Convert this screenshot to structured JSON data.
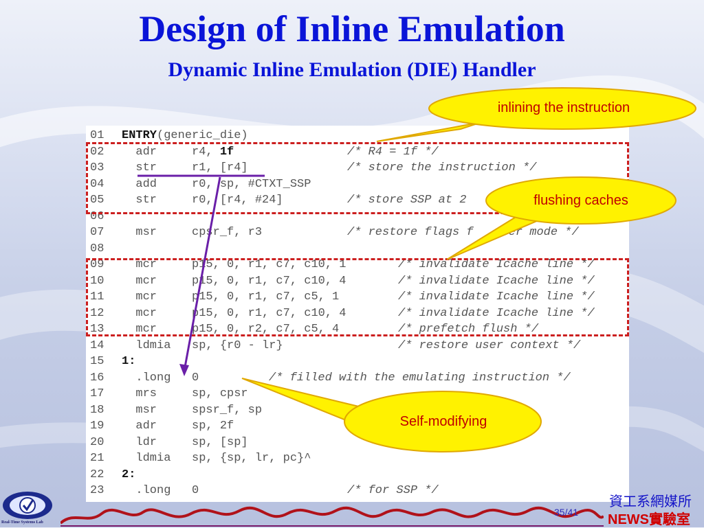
{
  "slide": {
    "title": "Design of Inline Emulation",
    "subtitle": "Dynamic Inline Emulation (DIE) Handler",
    "page_number": "35/41",
    "lab_caption": "Real-Time Systems Lab",
    "dept_line1": "資工系網媒所",
    "dept_line2": "NEWS實驗室"
  },
  "callouts": {
    "inlining": "inlining the instruction",
    "flushing": "flushing caches",
    "self_modifying": "Self-modifying"
  },
  "code_lines": [
    {
      "ln": "01",
      "pre": "",
      "bold": "ENTRY",
      "rest": "(generic_die)",
      "comment": ""
    },
    {
      "ln": "02",
      "pre": "  adr     r4, ",
      "bold": "1f",
      "rest": "",
      "comment": "/* R4 = 1f */"
    },
    {
      "ln": "03",
      "pre": "  str     r1, [r4]",
      "bold": "",
      "rest": "",
      "comment": "/* store the instruction */"
    },
    {
      "ln": "04",
      "pre": "  add     r0, sp, #CTXT_SSP",
      "bold": "",
      "rest": "",
      "comment": ""
    },
    {
      "ln": "05",
      "pre": "  str     r0, [r4, #24]",
      "bold": "",
      "rest": "",
      "comment": "/* store SSP at 2"
    },
    {
      "ln": "06",
      "pre": "",
      "bold": "",
      "rest": "",
      "comment": ""
    },
    {
      "ln": "07",
      "pre": "  msr     cpsr_f, r3",
      "bold": "",
      "rest": "",
      "comment": "/* restore flags f   user mode */"
    },
    {
      "ln": "08",
      "pre": "",
      "bold": "",
      "rest": "",
      "comment": ""
    },
    {
      "ln": "09",
      "pre": "  mcr     p15, 0, r1, c7, c10, 1",
      "bold": "",
      "rest": "",
      "comment": "/* invalidate Icache line */"
    },
    {
      "ln": "10",
      "pre": "  mcr     p15, 0, r1, c7, c10, 4",
      "bold": "",
      "rest": "",
      "comment": "/* invalidate Icache line */"
    },
    {
      "ln": "11",
      "pre": "  mcr     p15, 0, r1, c7, c5, 1",
      "bold": "",
      "rest": "",
      "comment": "/* invalidate Icache line */"
    },
    {
      "ln": "12",
      "pre": "  mcr     p15, 0, r1, c7, c10, 4",
      "bold": "",
      "rest": "",
      "comment": "/* invalidate Icache line */"
    },
    {
      "ln": "13",
      "pre": "  mcr     p15, 0, r2, c7, c5, 4",
      "bold": "",
      "rest": "",
      "comment": "/* prefetch flush */"
    },
    {
      "ln": "14",
      "pre": "  ldmia   sp, {r0 - lr}",
      "bold": "",
      "rest": "",
      "comment": "/* restore user context */"
    },
    {
      "ln": "15",
      "pre": "",
      "bold": "1:",
      "rest": "",
      "comment": ""
    },
    {
      "ln": "16",
      "pre": "  .long   0",
      "bold": "",
      "rest": "",
      "comment": "/* filled with the emulating instruction */"
    },
    {
      "ln": "17",
      "pre": "  mrs     sp, cpsr",
      "bold": "",
      "rest": "",
      "comment": ""
    },
    {
      "ln": "18",
      "pre": "  msr     spsr_f, sp",
      "bold": "",
      "rest": "",
      "comment": ""
    },
    {
      "ln": "19",
      "pre": "  adr     sp, 2f",
      "bold": "",
      "rest": "",
      "comment": ""
    },
    {
      "ln": "20",
      "pre": "  ldr     sp, [sp]",
      "bold": "",
      "rest": "",
      "comment": ""
    },
    {
      "ln": "21",
      "pre": "  ldmia   sp, {sp, lr, pc}^",
      "bold": "",
      "rest": "",
      "comment": ""
    },
    {
      "ln": "22",
      "pre": "",
      "bold": "2:",
      "rest": "",
      "comment": ""
    },
    {
      "ln": "23",
      "pre": "  .long   0",
      "bold": "",
      "rest": "",
      "comment": "/* for SSP */"
    }
  ],
  "colors": {
    "title": "#0a14d8",
    "dash_box": "#cc1f1f",
    "callout_fill": "#fff200",
    "callout_text": "#c00000",
    "arrow": "#6a1fa8"
  }
}
